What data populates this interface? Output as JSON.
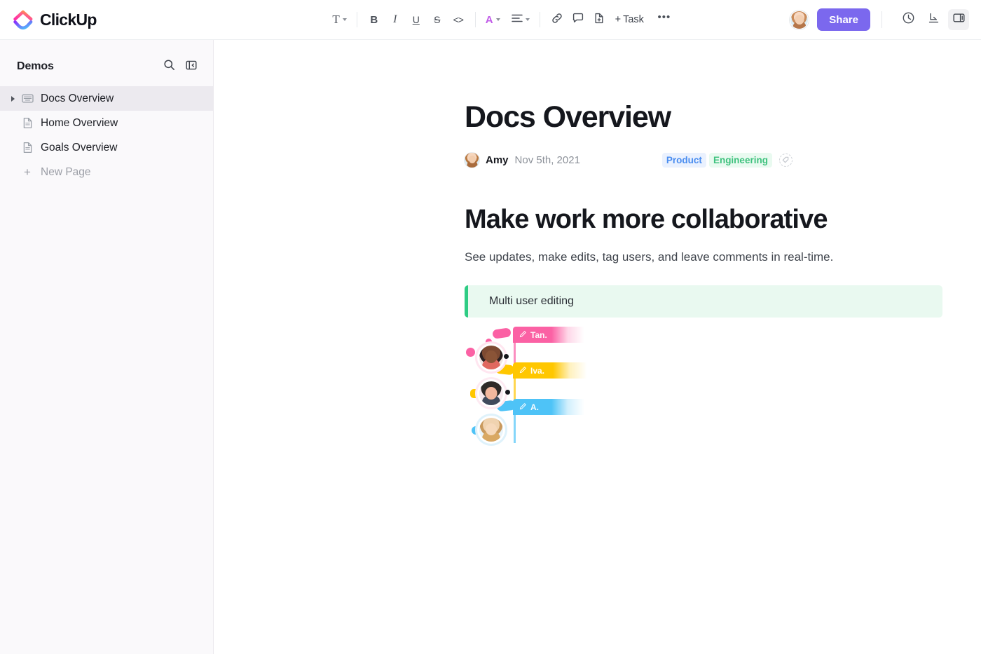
{
  "app": {
    "brand_name": "ClickUp",
    "logo_icon": "clickup-logo-icon"
  },
  "toolbar": {
    "text_style_label": "T",
    "text_style_icon": "text-style-icon",
    "bold_label": "B",
    "italic_label": "I",
    "underline_label": "U",
    "strikethrough_label": "S",
    "code_label": "<>",
    "font_color_label": "A",
    "align_icon": "align-left-icon",
    "link_icon": "link-icon",
    "comment_icon": "comment-icon",
    "page_icon": "page-add-icon",
    "task_label": "Task",
    "task_plus": "+",
    "more_label": "•••"
  },
  "topright": {
    "avatar_icon": "user-avatar",
    "share_label": "Share",
    "history_icon": "clock-history-icon",
    "collapse_icon": "collapse-arrow-icon",
    "panel_icon": "side-panel-icon"
  },
  "sidebar": {
    "title": "Demos",
    "search_icon": "search-icon",
    "collapse_icon": "sidebar-collapse-icon",
    "items": [
      {
        "label": "Docs Overview",
        "icon": "doc-book-icon",
        "active": true,
        "expandable": true
      },
      {
        "label": "Home Overview",
        "icon": "document-icon",
        "active": false,
        "expandable": false
      },
      {
        "label": "Goals Overview",
        "icon": "document-icon",
        "active": false,
        "expandable": false
      }
    ],
    "new_page_label": "New Page",
    "new_page_icon": "plus-icon"
  },
  "document": {
    "title": "Docs Overview",
    "author": "Amy",
    "date": "Nov 5th, 2021",
    "tags": [
      {
        "label": "Product",
        "color": "#4a8df0",
        "bg": "#eaf1fe"
      },
      {
        "label": "Engineering",
        "color": "#3fc27e",
        "bg": "#e9faf0"
      }
    ],
    "tag_add_icon": "add-tag-icon",
    "heading": "Make work more collaborative",
    "paragraph": "See updates, make edits, tag users, and leave comments in real-time.",
    "callout": {
      "text": "Multi user editing",
      "accent": "#2ecc84",
      "bg": "#e9f9f0"
    },
    "cursors": [
      {
        "name": "Tan.",
        "color": "#f9609b",
        "icon": "pencil-icon"
      },
      {
        "name": "Iva.",
        "color": "#ffc700",
        "icon": "pencil-icon"
      },
      {
        "name": "A.",
        "color": "#4ec3f7",
        "icon": "pencil-icon"
      }
    ]
  }
}
